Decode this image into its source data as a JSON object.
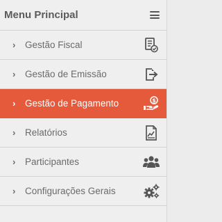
{
  "menu": {
    "title": "Menu Principal",
    "items": [
      {
        "label": "Gestão Fiscal",
        "chevron": "›",
        "icon": "document-check-icon",
        "active": false
      },
      {
        "label": "Gestão de Emissão",
        "chevron": "›",
        "icon": "export-icon",
        "active": false
      },
      {
        "label": "Gestão de Pagamento",
        "chevron": "›",
        "icon": "payment-hand-icon",
        "active": true
      },
      {
        "label": "Relatórios",
        "chevron": "›",
        "icon": "report-chart-icon",
        "active": false
      },
      {
        "label": "Participantes",
        "chevron": "›",
        "icon": "users-group-icon",
        "active": false
      },
      {
        "label": "Configurações Gerais",
        "chevron": "›",
        "icon": "gears-icon",
        "active": false
      }
    ]
  },
  "colors": {
    "active_bg": "#e65a3c",
    "text": "#6a6a6a",
    "icon": "#555555",
    "header_text": "#5b5b5b"
  }
}
